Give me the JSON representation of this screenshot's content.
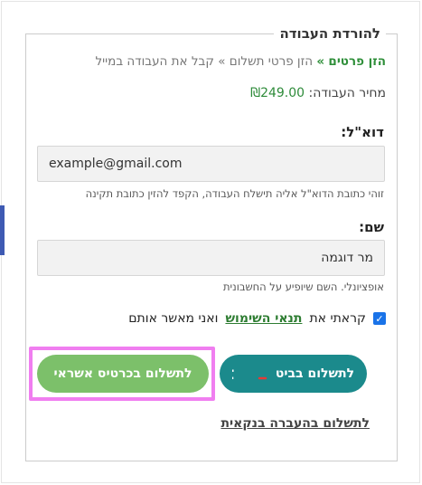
{
  "form": {
    "legend": "להורדת העבודה",
    "breadcrumb": {
      "step1": "הזן פרטים",
      "sep1": "»",
      "step2": "הזן פרטי תשלום",
      "sep2": "»",
      "step3": "קבל את העבודה במייל"
    },
    "price": {
      "label": "מחיר העבודה:",
      "value": "₪249.00"
    },
    "email": {
      "label": "דוא\"ל:",
      "value": "example@gmail.com",
      "hint": "זוהי כתובת הדוא\"ל אליה תישלח העבודה, הקפד להזין כתובת תקינה"
    },
    "name": {
      "label": "שם:",
      "value": "מר דוגמה",
      "hint": "אופציונלי. השם שיופיע על החשבונית"
    },
    "terms": {
      "prefix": "קראתי את",
      "link": "תנאי השימוש",
      "suffix": "ואני מאשר אותם",
      "checked": true
    },
    "buttons": {
      "card": "לתשלום בכרטיס אשראי",
      "bit": "לתשלום בביט",
      "bit_logo": "bit"
    },
    "bank_link": "לתשלום בהעברה בנקאית"
  },
  "colors": {
    "card_button": "#7cc06a",
    "bit_button": "#1b8a8c",
    "highlight": "#f07ef0",
    "accent_green": "#2e8b3a"
  }
}
